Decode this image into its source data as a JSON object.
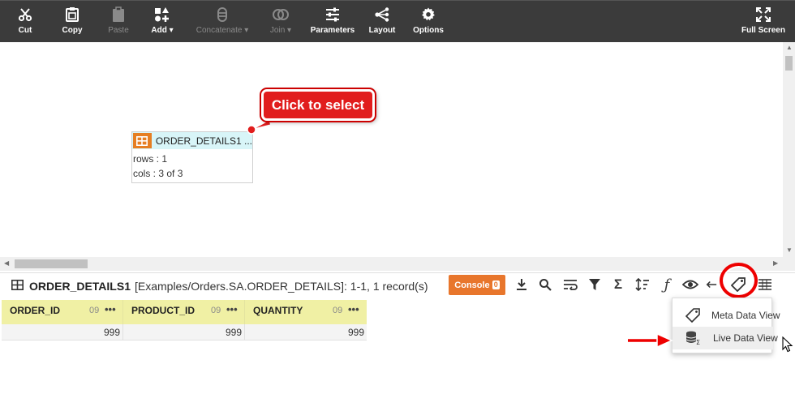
{
  "toolbar": {
    "cut": "Cut",
    "copy": "Copy",
    "paste": "Paste",
    "add": "Add",
    "concatenate": "Concatenate",
    "join": "Join",
    "parameters": "Parameters",
    "layout": "Layout",
    "options": "Options",
    "fullscreen": "Full Screen"
  },
  "canvas": {
    "node": {
      "name": "ORDER_DETAILS1 ...",
      "rows": "rows : 1",
      "cols": "cols : 3 of 3"
    },
    "callout": "Click to select"
  },
  "dataview": {
    "title": "ORDER_DETAILS1",
    "path": "[Examples/Orders.SA.ORDER_DETAILS]: 1-1, 1 record(s)",
    "console_label": "Console",
    "console_count": "0"
  },
  "grid": {
    "columns": [
      {
        "name": "ORDER_ID",
        "type": "09",
        "more": "•••"
      },
      {
        "name": "PRODUCT_ID",
        "type": "09",
        "more": "•••"
      },
      {
        "name": "QUANTITY",
        "type": "09",
        "more": "•••"
      }
    ],
    "rows": [
      [
        "999",
        "999",
        "999"
      ]
    ]
  },
  "menu": {
    "meta": "Meta Data View",
    "live": "Live Data View"
  },
  "colors": {
    "toolbar_bg": "#3b3b3b",
    "accent_orange": "#e8762c",
    "node_header": "#d8f5f8",
    "grid_header": "#f0f0a4",
    "annotation_red": "#e11d1d"
  }
}
